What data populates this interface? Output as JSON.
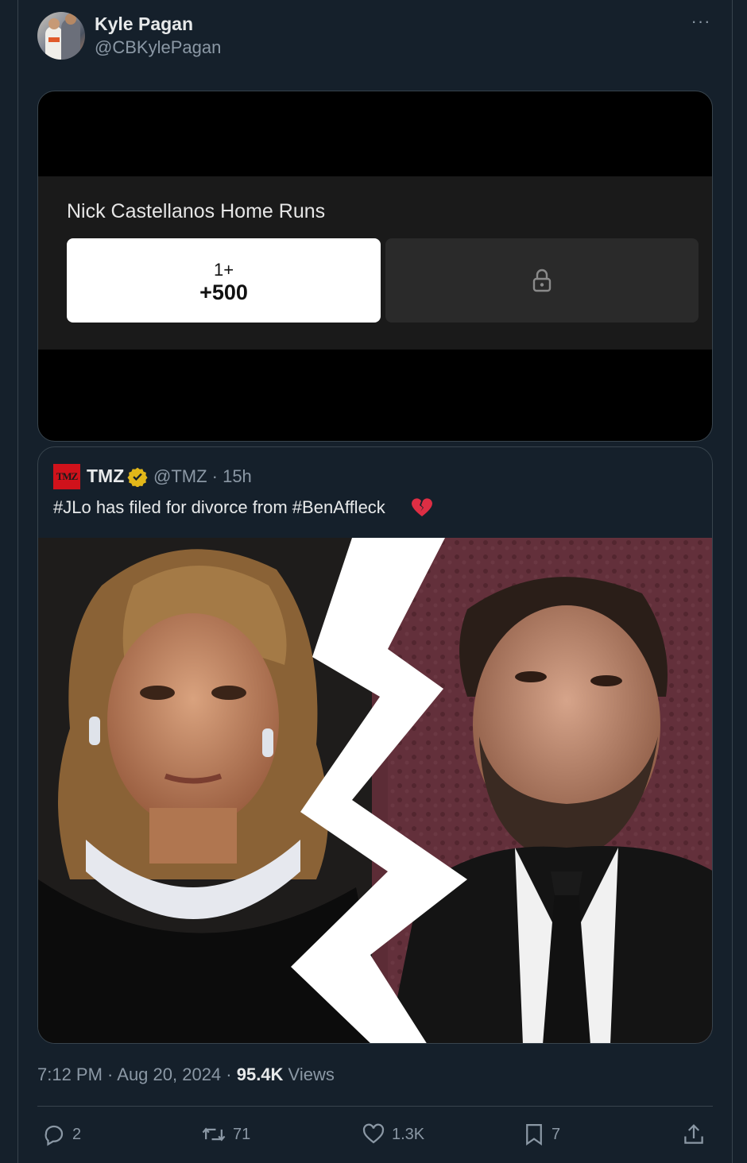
{
  "author": {
    "display_name": "Kyle Pagan",
    "handle": "@CBKylePagan",
    "more_label": "···"
  },
  "bet_card": {
    "title": "Nick Castellanos Home Runs",
    "option_selected": {
      "label": "1+",
      "odds": "+500"
    },
    "option_locked": {
      "icon": "lock-icon"
    }
  },
  "quoted_tweet": {
    "logo_text": "TMZ",
    "name": "TMZ",
    "handle_time": "@TMZ · 15h",
    "text": "#JLo has filed for divorce from #BenAffleck",
    "emoji": "broken-heart-icon"
  },
  "meta": {
    "time_date": "7:12 PM · Aug 20, 2024 · ",
    "views_count": "95.4K",
    "views_label": " Views"
  },
  "actions": {
    "replies": "2",
    "reposts": "71",
    "likes": "1.3K",
    "bookmarks": "7"
  },
  "colors": {
    "background": "#15202b",
    "border": "#38444d",
    "text_secondary": "#8b98a5",
    "tmz_red": "#d0121b",
    "verified_gold": "#e2b719"
  }
}
